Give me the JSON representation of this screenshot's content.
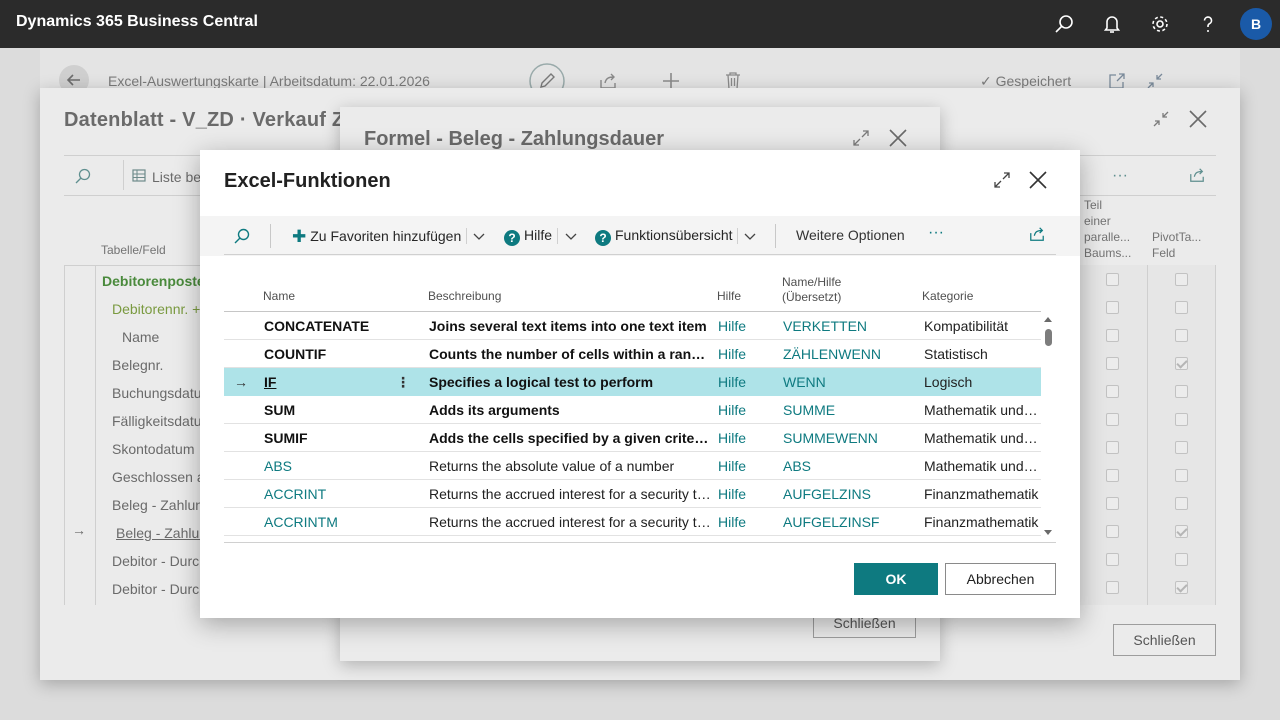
{
  "app": {
    "title": "Dynamics 365 Business Central",
    "user_initial": "B",
    "icons": [
      "search-icon",
      "bell-icon",
      "gear-icon",
      "help-icon"
    ]
  },
  "page": {
    "breadcrumb": "Excel-Auswertungskarte | Arbeitsdatum: 22.01.2026",
    "saved_label": "Gespeichert"
  },
  "dialog1": {
    "title": "Datenblatt - V_ZD · Verkauf Za",
    "toolbar_list": "Liste be",
    "col_table": "Tabelle/Feld",
    "col_teil": [
      "Teil",
      "einer",
      "paralle...",
      "Baums..."
    ],
    "col_pivot": [
      "PivotTa...",
      "Feld"
    ],
    "group_label": "Debitorenposte",
    "subgroup_label": "Debitorennr. +",
    "name_header": "Name",
    "rows": [
      "Belegnr.",
      "Buchungsdatu",
      "Fälligkeitsdatu",
      "Skontodatum",
      "Geschlossen a",
      "Beleg - Zahlun",
      "Beleg - Zahlur",
      "Debitor - Durc",
      "Debitor - Durc"
    ],
    "close_label": "Schließen"
  },
  "dialog2": {
    "title": "Formel - Beleg - Zahlungsdauer",
    "close_label": "Schließen"
  },
  "dialog3": {
    "title": "Excel-Funktionen",
    "toolbar": {
      "add_favorites": "Zu Favoriten hinzufügen",
      "help": "Hilfe",
      "overview": "Funktionsübersicht",
      "more": "Weitere Optionen",
      "ellipsis": "···"
    },
    "columns": {
      "name": "Name",
      "description": "Beschreibung",
      "help": "Hilfe",
      "translated_1": "Name/Hilfe",
      "translated_2": "(Übersetzt)",
      "category": "Kategorie"
    },
    "rows": [
      {
        "name": "CONCATENATE",
        "desc": "Joins several text items into one text item",
        "help": "Hilfe",
        "translated": "VERKETTEN",
        "category": "Kompatibilität",
        "bold": true
      },
      {
        "name": "COUNTIF",
        "desc": "Counts the number of cells within a range that meet the given condition",
        "help": "Hilfe",
        "translated": "ZÄHLENWENN",
        "category": "Statistisch",
        "bold": true
      },
      {
        "name": "IF",
        "desc": "Specifies a logical test to perform",
        "help": "Hilfe",
        "translated": "WENN",
        "category": "Logisch",
        "bold": true,
        "selected": true
      },
      {
        "name": "SUM",
        "desc": "Adds its arguments",
        "help": "Hilfe",
        "translated": "SUMME",
        "category": "Mathematik und Trigonometrie",
        "bold": true
      },
      {
        "name": "SUMIF",
        "desc": "Adds the cells specified by a given criteria",
        "help": "Hilfe",
        "translated": "SUMMEWENN",
        "category": "Mathematik und Trigonometrie",
        "bold": true
      },
      {
        "name": "ABS",
        "desc": "Returns the absolute value of a number",
        "help": "Hilfe",
        "translated": "ABS",
        "category": "Mathematik und Trigonometrie",
        "bold": false
      },
      {
        "name": "ACCRINT",
        "desc": "Returns the accrued interest for a security that pays periodic interest",
        "help": "Hilfe",
        "translated": "AUFGELZINS",
        "category": "Finanzmathematik",
        "bold": false
      },
      {
        "name": "ACCRINTM",
        "desc": "Returns the accrued interest for a security that pays interest at maturity",
        "help": "Hilfe",
        "translated": "AUFGELZINSF",
        "category": "Finanzmathematik",
        "bold": false
      }
    ],
    "ok_label": "OK",
    "cancel_label": "Abbrechen"
  },
  "colors": {
    "topbar": "#2b2b2b",
    "accent": "#0e7a80",
    "selected_row": "#aee3e8",
    "avatar": "#1a5aa8"
  }
}
